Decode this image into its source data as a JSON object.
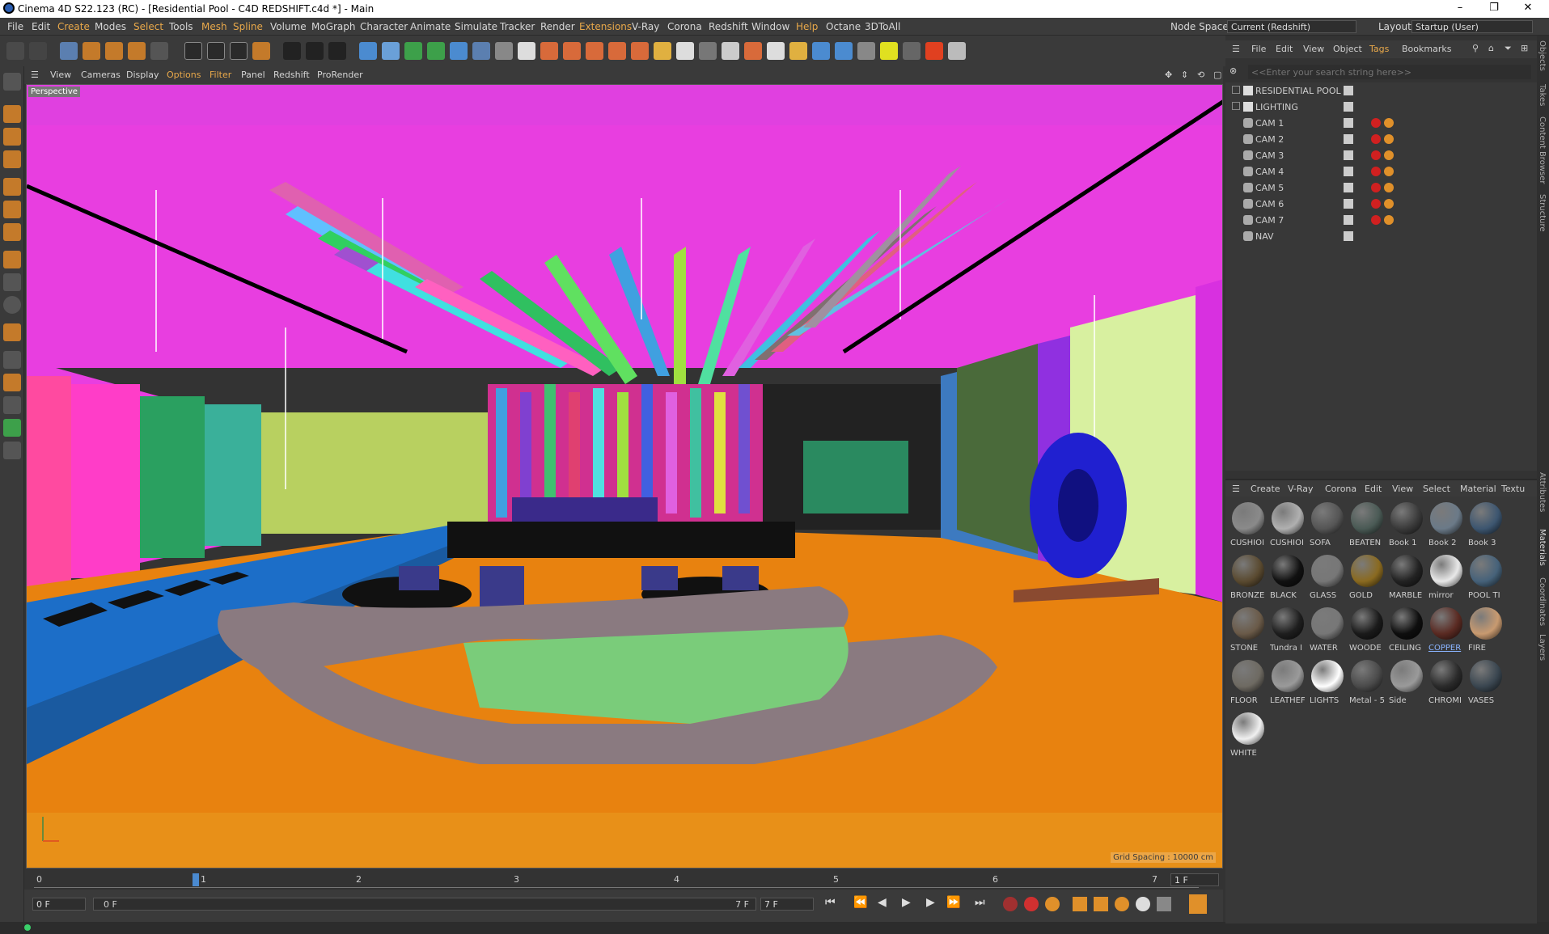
{
  "window": {
    "title": "Cinema 4D S22.123 (RC) - [Residential Pool - C4D REDSHIFT.c4d *] - Main",
    "minimize": "–",
    "maximize": "❐",
    "close": "✕"
  },
  "menubar": {
    "items": [
      "File",
      "Edit",
      "Create",
      "Modes",
      "Select",
      "Tools",
      "Mesh",
      "Spline",
      "Volume",
      "MoGraph",
      "Character",
      "Animate",
      "Simulate",
      "Tracker",
      "Render",
      "Extensions",
      "V-Ray",
      "Corona",
      "Redshift",
      "Window",
      "Help",
      "Octane",
      "3DToAll"
    ],
    "node_space_label": "Node Space:",
    "node_space_value": "Current (Redshift)",
    "layout_label": "Layout:",
    "layout_value": "Startup (User)"
  },
  "viewport": {
    "menu": [
      "View",
      "Cameras",
      "Display",
      "Options",
      "Filter",
      "Panel",
      "Redshift",
      "ProRender"
    ],
    "camera_label": "Perspective",
    "grid_spacing": "Grid Spacing : 10000 cm"
  },
  "timeline": {
    "ticks": [
      "0",
      "1",
      "2",
      "3",
      "4",
      "5",
      "6",
      "7"
    ],
    "current_frame": "1 F",
    "start_frame": "0 F",
    "range_start": "0 F",
    "range_end": "7 F",
    "end_frame": "7 F"
  },
  "objects_panel": {
    "menu": [
      "File",
      "Edit",
      "View",
      "Object",
      "Tags",
      "Bookmarks"
    ],
    "search_placeholder": "<<Enter your search string here>>",
    "items": [
      {
        "name": "RESIDENTIAL POOL",
        "type": "layer"
      },
      {
        "name": "LIGHTING",
        "type": "layer"
      },
      {
        "name": "CAM 1",
        "type": "camera"
      },
      {
        "name": "CAM 2",
        "type": "camera"
      },
      {
        "name": "CAM 3",
        "type": "camera"
      },
      {
        "name": "CAM 4",
        "type": "camera"
      },
      {
        "name": "CAM 5",
        "type": "camera"
      },
      {
        "name": "CAM 6",
        "type": "camera"
      },
      {
        "name": "CAM 7",
        "type": "camera"
      },
      {
        "name": "NAV",
        "type": "camera"
      }
    ]
  },
  "materials_panel": {
    "menu": [
      "Create",
      "V-Ray",
      "Corona",
      "Edit",
      "View",
      "Select",
      "Material",
      "Textu"
    ],
    "materials": [
      {
        "name": "CUSHIOI",
        "color": "#8a8a8a"
      },
      {
        "name": "CUSHIOI",
        "color": "#b0b0b0"
      },
      {
        "name": "SOFA",
        "color": "#555555"
      },
      {
        "name": "BEATEN",
        "color": "#4a5a55"
      },
      {
        "name": "Book 1",
        "color": "#3a3a3a"
      },
      {
        "name": "Book 2",
        "color": "#6b7a88"
      },
      {
        "name": "Book 3",
        "color": "#3d5670"
      },
      {
        "name": "BRONZE",
        "color": "#5a4a30"
      },
      {
        "name": "BLACK",
        "color": "#111111"
      },
      {
        "name": "GLASS",
        "color": "#777777"
      },
      {
        "name": "GOLD",
        "color": "#8a6a20"
      },
      {
        "name": "MARBLE",
        "color": "#222222"
      },
      {
        "name": "mirror",
        "color": "#e8e8e8"
      },
      {
        "name": "POOL TI",
        "color": "#46627a"
      },
      {
        "name": "STONE",
        "color": "#6a5a48"
      },
      {
        "name": "Tundra I",
        "color": "#1e1e1e"
      },
      {
        "name": "WATER",
        "color": "#777777"
      },
      {
        "name": "WOODE",
        "color": "#1a1a1a"
      },
      {
        "name": "CEILING",
        "color": "#0e0e0e"
      },
      {
        "name": "COPPER",
        "color": "#5a2a22"
      },
      {
        "name": "FIRE",
        "color": "#c89a70"
      },
      {
        "name": "FLOOR",
        "color": "#6e6a62"
      },
      {
        "name": "LEATHEF",
        "color": "#9a9a9a"
      },
      {
        "name": "LIGHTS",
        "color": "#ffffff"
      },
      {
        "name": "Metal - 5",
        "color": "#4a4a4a"
      },
      {
        "name": "Side",
        "color": "#9a9a9a"
      },
      {
        "name": "CHROMI",
        "color": "#2a2a2a"
      },
      {
        "name": "VASES",
        "color": "#3a4650"
      },
      {
        "name": "WHITE",
        "color": "#f0f0f0"
      }
    ],
    "selected": "COPPER"
  },
  "side_tabs": {
    "top": [
      "Objects",
      "Takes",
      "Content Browser",
      "Structure"
    ],
    "bottom": [
      "Attributes",
      "Materials",
      "Coordinates",
      "Layers"
    ]
  },
  "colors": {
    "accent": "#e8a84a",
    "panel_bg": "#3a3a3a",
    "viewport_floor": "#e8820f",
    "viewport_wall": "#e040e0"
  }
}
